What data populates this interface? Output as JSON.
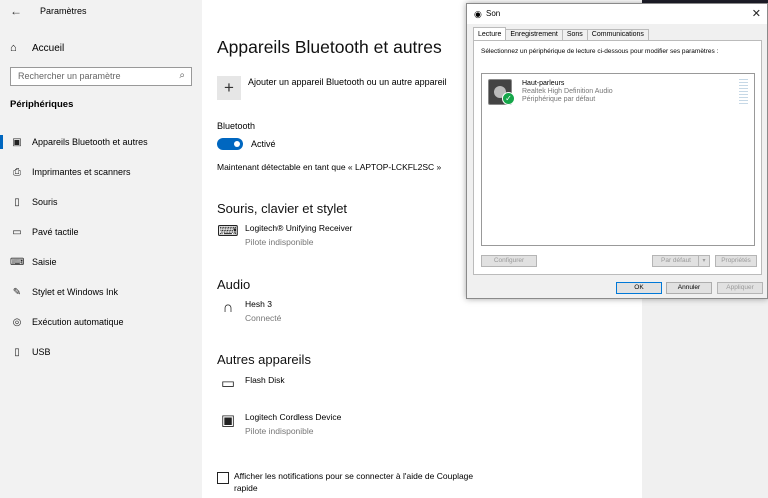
{
  "settings": {
    "app_title": "Paramètres",
    "back_glyph": "←",
    "home": {
      "label": "Accueil",
      "icon": "home-icon"
    },
    "search": {
      "placeholder": "Rechercher un paramètre",
      "icon": "search-icon"
    },
    "section_title": "Périphériques",
    "nav": [
      {
        "label": "Appareils Bluetooth et autres",
        "icon": "bluetooth-devices-icon",
        "selected": true
      },
      {
        "label": "Imprimantes et scanners",
        "icon": "printer-icon"
      },
      {
        "label": "Souris",
        "icon": "mouse-icon"
      },
      {
        "label": "Pavé tactile",
        "icon": "touchpad-icon"
      },
      {
        "label": "Saisie",
        "icon": "keyboard-icon"
      },
      {
        "label": "Stylet et Windows Ink",
        "icon": "pen-icon"
      },
      {
        "label": "Exécution automatique",
        "icon": "autoplay-icon"
      },
      {
        "label": "USB",
        "icon": "usb-icon"
      }
    ],
    "content": {
      "title": "Appareils Bluetooth et autres",
      "add_label": "Ajouter un appareil Bluetooth ou un autre appareil",
      "add_glyph": "+",
      "bluetooth_label": "Bluetooth",
      "bluetooth_state": "Activé",
      "bluetooth_on": true,
      "discoverable": "Maintenant détectable en tant que « LAPTOP-LCKFL2SC »",
      "sections": [
        {
          "title": "Souris, clavier et stylet",
          "devices": [
            {
              "name": "Logitech® Unifying Receiver",
              "status": "Pilote indisponible",
              "icon": "keyboard-icon"
            }
          ]
        },
        {
          "title": "Audio",
          "devices": [
            {
              "name": "Hesh 3",
              "status": "Connecté",
              "icon": "headset-icon"
            }
          ]
        },
        {
          "title": "Autres appareils",
          "devices": [
            {
              "name": "Flash Disk",
              "status": "",
              "icon": "flash-drive-icon"
            },
            {
              "name": "Logitech Cordless Device",
              "status": "Pilote indisponible",
              "icon": "device-icon"
            }
          ]
        }
      ],
      "notification_checkbox": "Afficher les notifications pour se connecter à l'aide de Couplage rapide",
      "notification_checked": false
    }
  },
  "dialog": {
    "title": "Son",
    "close_glyph": "✕",
    "tabs": [
      "Lecture",
      "Enregistrement",
      "Sons",
      "Communications"
    ],
    "active_tab": 0,
    "instruction": "Sélectionnez un périphérique de lecture ci-dessous pour modifier ses paramètres :",
    "device": {
      "name": "Haut-parleurs",
      "driver": "Realtek High Definition Audio",
      "status": "Périphérique par défaut",
      "check_glyph": "✓"
    },
    "buttons": {
      "configure": "Configurer",
      "set_default": "Par défaut",
      "dropdown_glyph": "▾",
      "properties": "Propriétés",
      "ok": "OK",
      "cancel": "Annuler",
      "apply": "Appliquer"
    }
  },
  "colors": {
    "accent": "#0067c0",
    "default_device_check": "#15a64a",
    "sidebar_bg": "#f2f2f2"
  }
}
